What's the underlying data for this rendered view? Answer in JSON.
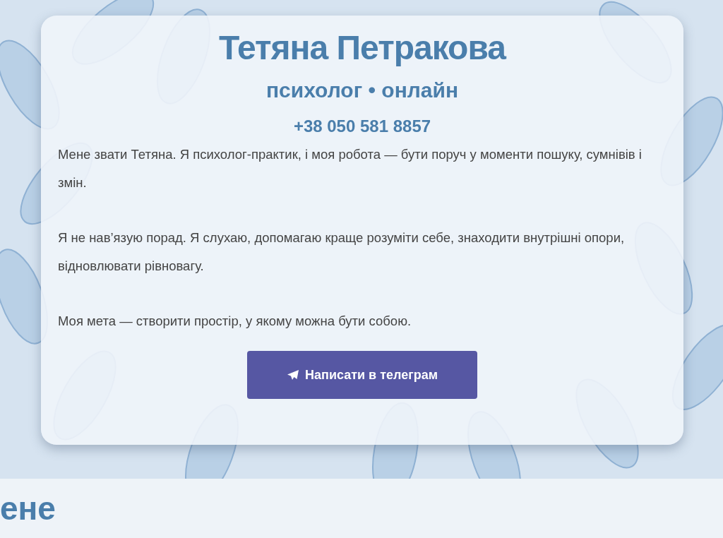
{
  "hero": {
    "name": "Тетяна Петракова",
    "subtitle": "психолог • онлайн",
    "phone": "+38 050 581 8857",
    "paragraphs": [
      "Мене звати Тетяна. Я психолог-практик, і моя робота — бути поруч у моменти пошуку, сумнівів і змін.",
      "Я не нав’язую порад. Я слухаю, допомагаю краще розуміти себе, знаходити внутрішні опори, відновлювати рівновагу.",
      "Моя мета — створити простір, у якому можна бути собою."
    ],
    "button": "Написати в телеграм"
  },
  "section": {
    "heading": "ене"
  }
}
